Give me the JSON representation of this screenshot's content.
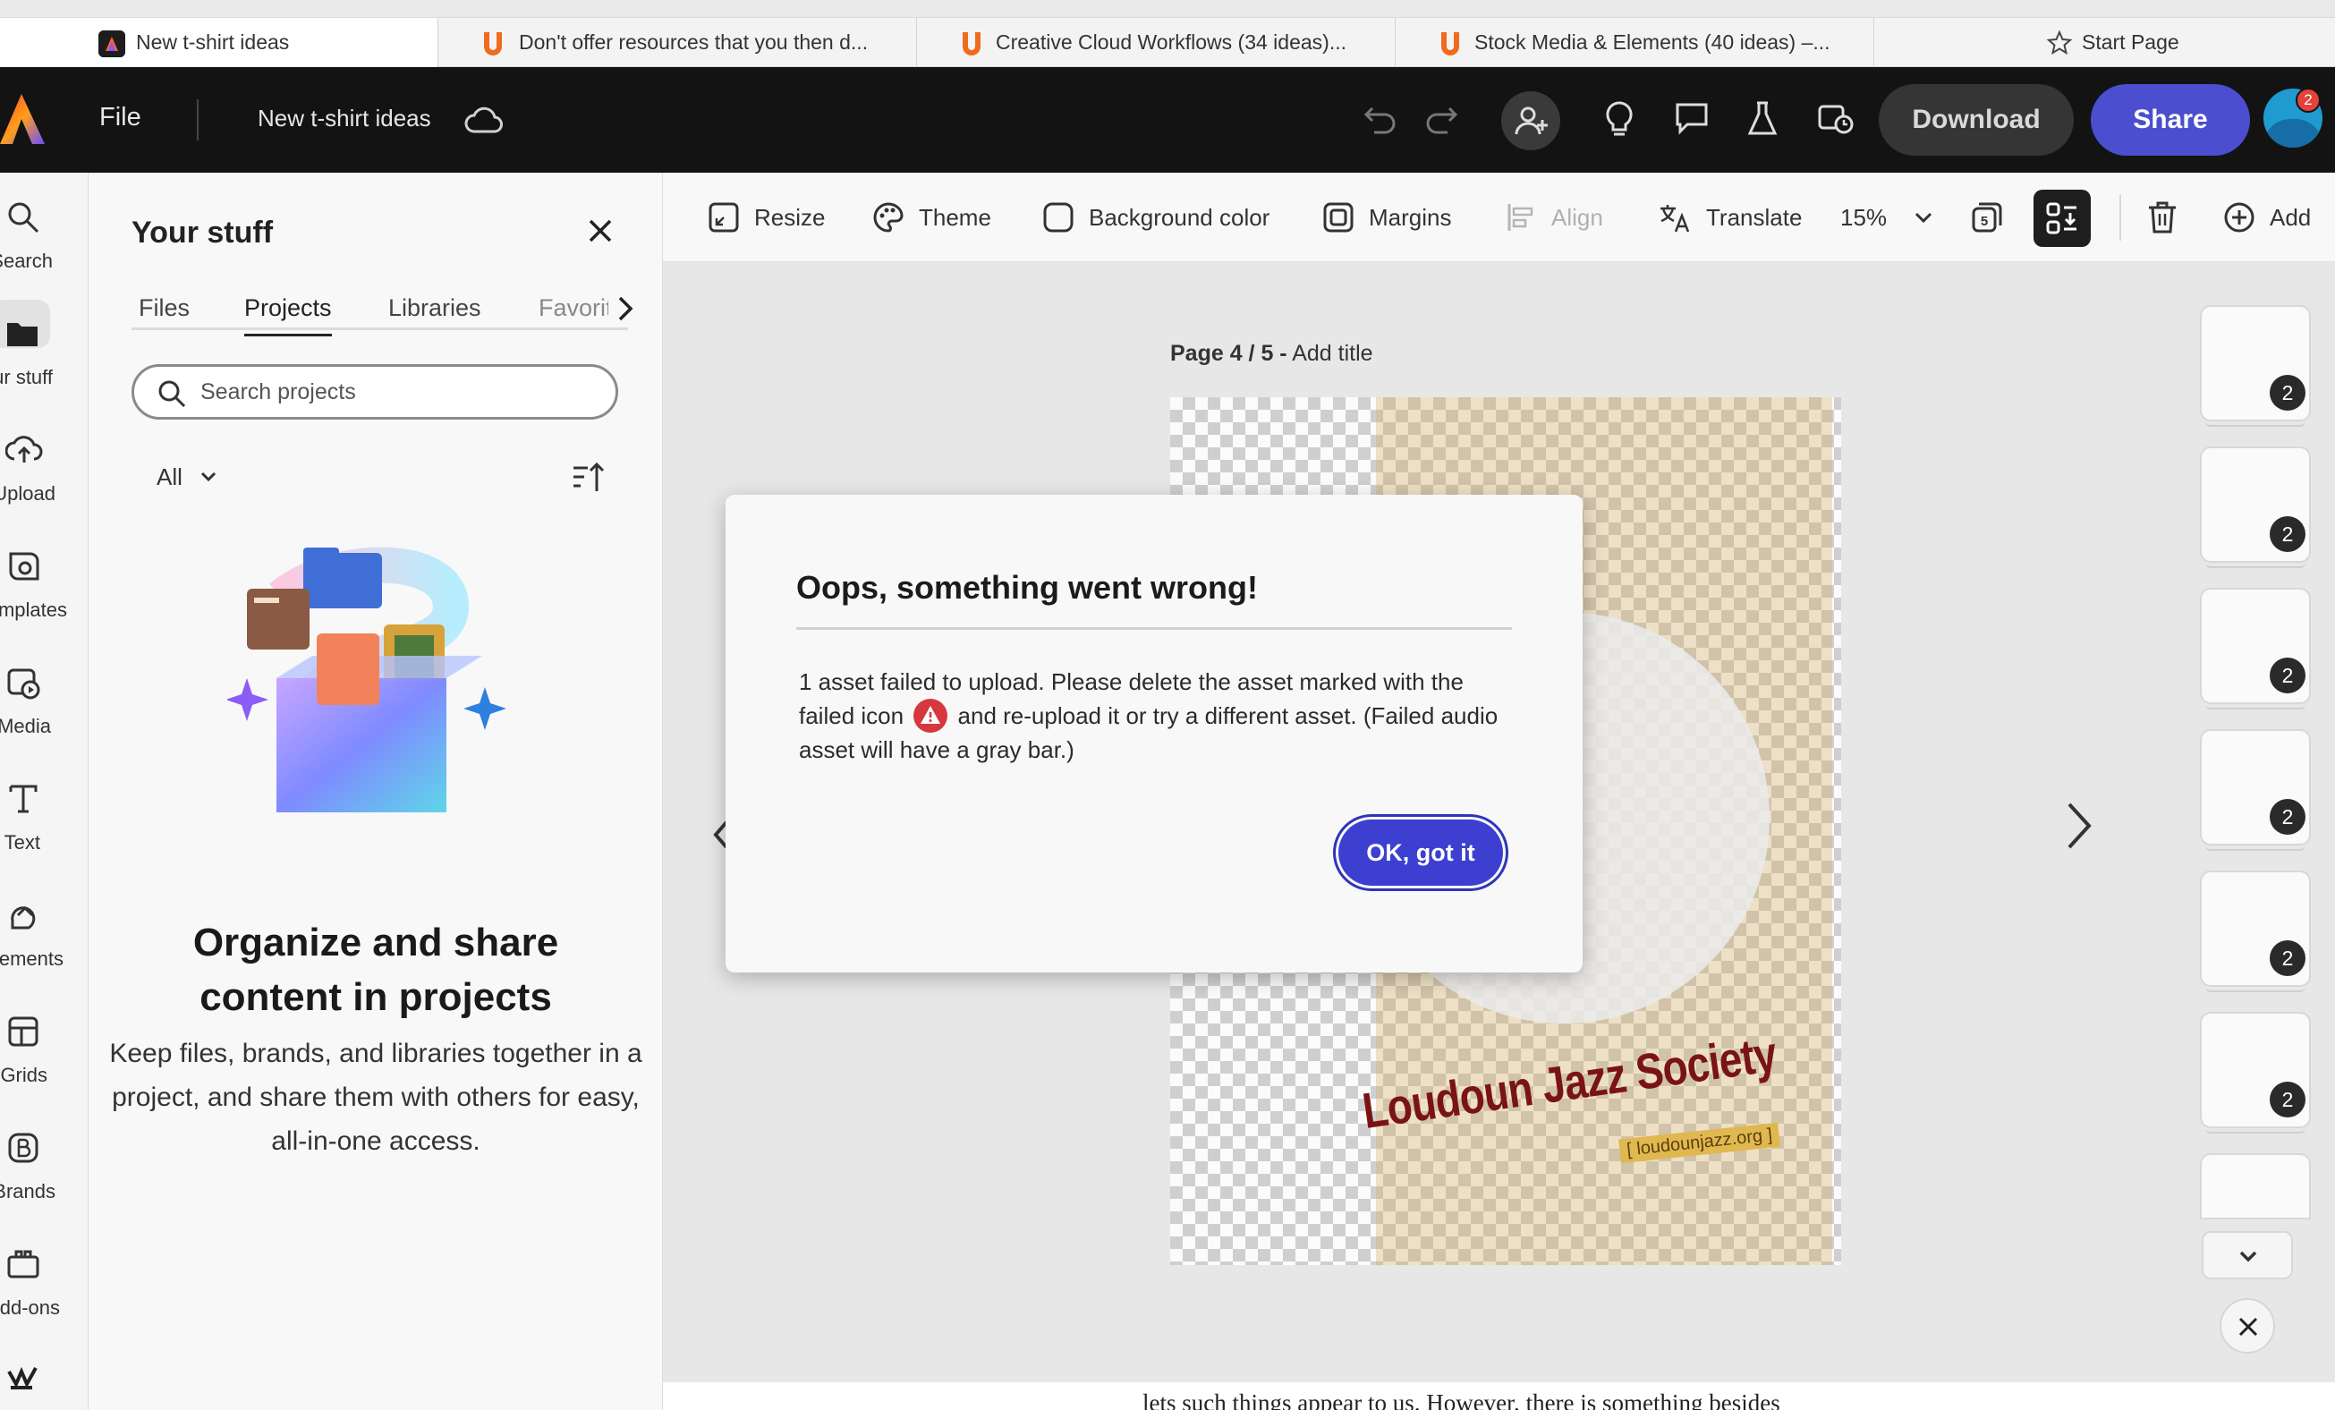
{
  "browser_tabs": [
    {
      "label": "New t-shirt ideas",
      "active": true
    },
    {
      "label": "Don't offer resources that you then d...",
      "active": false
    },
    {
      "label": "Creative Cloud Workflows (34 ideas)...",
      "active": false
    },
    {
      "label": "Stock Media & Elements (40 ideas) –...",
      "active": false
    },
    {
      "label": "Start Page",
      "active": false
    }
  ],
  "header": {
    "file_label": "File",
    "doc_title": "New t-shirt ideas",
    "download_label": "Download",
    "share_label": "Share",
    "notification_count": "2"
  },
  "rail": [
    {
      "label": "Search",
      "icon": "search-icon"
    },
    {
      "label": "Your stuff",
      "icon": "folder-icon",
      "selected": true
    },
    {
      "label": "Upload",
      "icon": "upload-icon"
    },
    {
      "label": "Templates",
      "icon": "templates-icon"
    },
    {
      "label": "Media",
      "icon": "media-icon"
    },
    {
      "label": "Text",
      "icon": "text-icon"
    },
    {
      "label": "Elements",
      "icon": "elements-icon"
    },
    {
      "label": "Grids",
      "icon": "grids-icon"
    },
    {
      "label": "Brands",
      "icon": "brands-icon"
    },
    {
      "label": "Add-ons",
      "icon": "addons-icon"
    }
  ],
  "panel": {
    "title": "Your stuff",
    "tabs": [
      "Files",
      "Projects",
      "Libraries",
      "Favorites"
    ],
    "active_tab": "Projects",
    "search_placeholder": "Search projects",
    "filter_label": "All",
    "promo_title": "Organize and share content in projects",
    "promo_body": "Keep files, brands, and libraries together in a project, and share them with others for easy, all-in-one access."
  },
  "toolbar": {
    "resize": "Resize",
    "theme": "Theme",
    "background_color": "Background color",
    "margins": "Margins",
    "align": "Align",
    "translate": "Translate",
    "zoom": "15%",
    "add": "Add"
  },
  "canvas": {
    "page_label": "Page 4 / 5 -",
    "add_title": "Add title",
    "artwork_brand": "Loudoun Jazz Society",
    "artwork_url": "[ loudounjazz.org ]",
    "thumbnails": [
      "2",
      "2",
      "2",
      "2",
      "2",
      "2"
    ]
  },
  "modal": {
    "title": "Oops, something went wrong!",
    "body_before_icon": "1 asset failed to upload. Please delete the asset marked with the failed icon",
    "body_after_icon": "and re-upload it or try a different asset. (Failed audio asset will have a gray bar.)",
    "ok_label": "OK, got it"
  },
  "background_document_text": "lets such things appear to us.  However, there is something besides",
  "colors": {
    "accent": "#4b4ecf",
    "header_bg": "#131313",
    "error": "#d7373f"
  }
}
